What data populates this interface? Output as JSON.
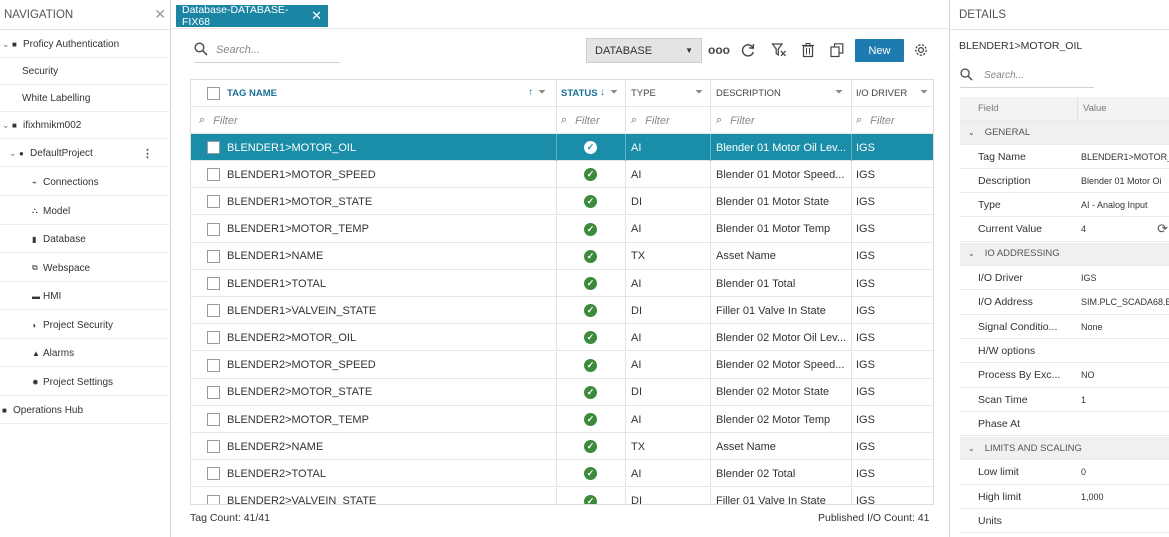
{
  "nav": {
    "title": "NAVIGATION",
    "items": [
      {
        "label": "Proficy Authentication",
        "indent": 0,
        "chev": "⌄",
        "icon": "■"
      },
      {
        "label": "Security",
        "indent": 1,
        "chev": "",
        "icon": ""
      },
      {
        "label": "White Labelling",
        "indent": 1,
        "chev": "",
        "icon": ""
      },
      {
        "label": "ifixhmikm002",
        "indent": 0,
        "chev": "⌄",
        "icon": "■"
      },
      {
        "label": "DefaultProject",
        "indent": 1,
        "chev": "⌄",
        "icon": "●",
        "more": "⋮"
      },
      {
        "label": "Connections",
        "indent": 2,
        "chev": "",
        "icon": "⌁"
      },
      {
        "label": "Model",
        "indent": 2,
        "chev": "",
        "icon": "⛬"
      },
      {
        "label": "Database",
        "indent": 2,
        "chev": "",
        "icon": "▮"
      },
      {
        "label": "Webspace",
        "indent": 2,
        "chev": "",
        "icon": "⧉"
      },
      {
        "label": "HMI",
        "indent": 2,
        "chev": "",
        "icon": "▬"
      },
      {
        "label": "Project Security",
        "indent": 2,
        "chev": "",
        "icon": "◗"
      },
      {
        "label": "Alarms",
        "indent": 2,
        "chev": "",
        "icon": "▲"
      },
      {
        "label": "Project Settings",
        "indent": 2,
        "chev": "",
        "icon": "✹"
      },
      {
        "label": "Operations Hub",
        "indent": 0,
        "chev": "",
        "icon": "■"
      }
    ]
  },
  "tab": {
    "label": "Database-DATABASE-FIX68",
    "close": "✕"
  },
  "toolbar": {
    "search_placeholder": "Search...",
    "database_select": "DATABASE",
    "new_label": "New"
  },
  "grid": {
    "headers": {
      "tag": "TAG NAME",
      "status": "STATUS",
      "type": "TYPE",
      "desc": "DESCRIPTION",
      "driver": "I/O DRIVER"
    },
    "filter_placeholder": "Filter",
    "rows": [
      {
        "tag": "BLENDER1>MOTOR_OIL",
        "type": "AI",
        "desc": "Blender 01 Motor Oil Lev...",
        "driver": "IGS",
        "selected": true
      },
      {
        "tag": "BLENDER1>MOTOR_SPEED",
        "type": "AI",
        "desc": "Blender 01 Motor Speed...",
        "driver": "IGS"
      },
      {
        "tag": "BLENDER1>MOTOR_STATE",
        "type": "DI",
        "desc": "Blender 01 Motor State",
        "driver": "IGS"
      },
      {
        "tag": "BLENDER1>MOTOR_TEMP",
        "type": "AI",
        "desc": "Blender 01 Motor Temp",
        "driver": "IGS"
      },
      {
        "tag": "BLENDER1>NAME",
        "type": "TX",
        "desc": "Asset Name",
        "driver": "IGS"
      },
      {
        "tag": "BLENDER1>TOTAL",
        "type": "AI",
        "desc": "Blender 01 Total",
        "driver": "IGS"
      },
      {
        "tag": "BLENDER1>VALVEIN_STATE",
        "type": "DI",
        "desc": "Filler 01 Valve In State",
        "driver": "IGS"
      },
      {
        "tag": "BLENDER2>MOTOR_OIL",
        "type": "AI",
        "desc": "Blender 02 Motor Oil Lev...",
        "driver": "IGS"
      },
      {
        "tag": "BLENDER2>MOTOR_SPEED",
        "type": "AI",
        "desc": "Blender 02 Motor Speed...",
        "driver": "IGS"
      },
      {
        "tag": "BLENDER2>MOTOR_STATE",
        "type": "DI",
        "desc": "Blender 02 Motor State",
        "driver": "IGS"
      },
      {
        "tag": "BLENDER2>MOTOR_TEMP",
        "type": "AI",
        "desc": "Blender 02 Motor Temp",
        "driver": "IGS"
      },
      {
        "tag": "BLENDER2>NAME",
        "type": "TX",
        "desc": "Asset Name",
        "driver": "IGS"
      },
      {
        "tag": "BLENDER2>TOTAL",
        "type": "AI",
        "desc": "Blender 02 Total",
        "driver": "IGS"
      },
      {
        "tag": "BLENDER2>VALVEIN_STATE",
        "type": "DI",
        "desc": "Filler 01 Valve In State",
        "driver": "IGS"
      }
    ]
  },
  "footer": {
    "tag_count": "Tag Count: 41/41",
    "published": "Published I/O Count: 41"
  },
  "details": {
    "title": "DETAILS",
    "item": "BLENDER1>MOTOR_OIL",
    "search_placeholder": "Search...",
    "col_field": "Field",
    "col_value": "Value",
    "rows": [
      {
        "kind": "group",
        "label": "GENERAL"
      },
      {
        "kind": "row",
        "field": "Tag Name",
        "value": "BLENDER1>MOTOR_"
      },
      {
        "kind": "row",
        "field": "Description",
        "value": "Blender 01 Motor Oi"
      },
      {
        "kind": "row",
        "field": "Type",
        "value": "AI - Analog Input"
      },
      {
        "kind": "row",
        "field": "Current Value",
        "value": "4",
        "refresh": true
      },
      {
        "kind": "group",
        "label": "IO ADDRESSING"
      },
      {
        "kind": "row",
        "field": "I/O Driver",
        "value": "IGS"
      },
      {
        "kind": "row",
        "field": "I/O Address",
        "value": "SIM.PLC_SCADA68.E"
      },
      {
        "kind": "row",
        "field": "Signal Conditio...",
        "value": "None"
      },
      {
        "kind": "row",
        "field": "H/W options",
        "value": ""
      },
      {
        "kind": "row",
        "field": "Process By Exc...",
        "value": "NO"
      },
      {
        "kind": "row",
        "field": "Scan Time",
        "value": "1"
      },
      {
        "kind": "row",
        "field": "Phase At",
        "value": ""
      },
      {
        "kind": "group",
        "label": "LIMITS AND SCALING"
      },
      {
        "kind": "row",
        "field": "Low limit",
        "value": "0"
      },
      {
        "kind": "row",
        "field": "High limit",
        "value": "1,000"
      },
      {
        "kind": "row",
        "field": "Units",
        "value": ""
      }
    ]
  },
  "colors": {
    "accent": "#1b86a4",
    "selected_row": "#1a8ea8",
    "primary_button": "#1e7bb0",
    "status_ok": "#3c8b3c"
  }
}
